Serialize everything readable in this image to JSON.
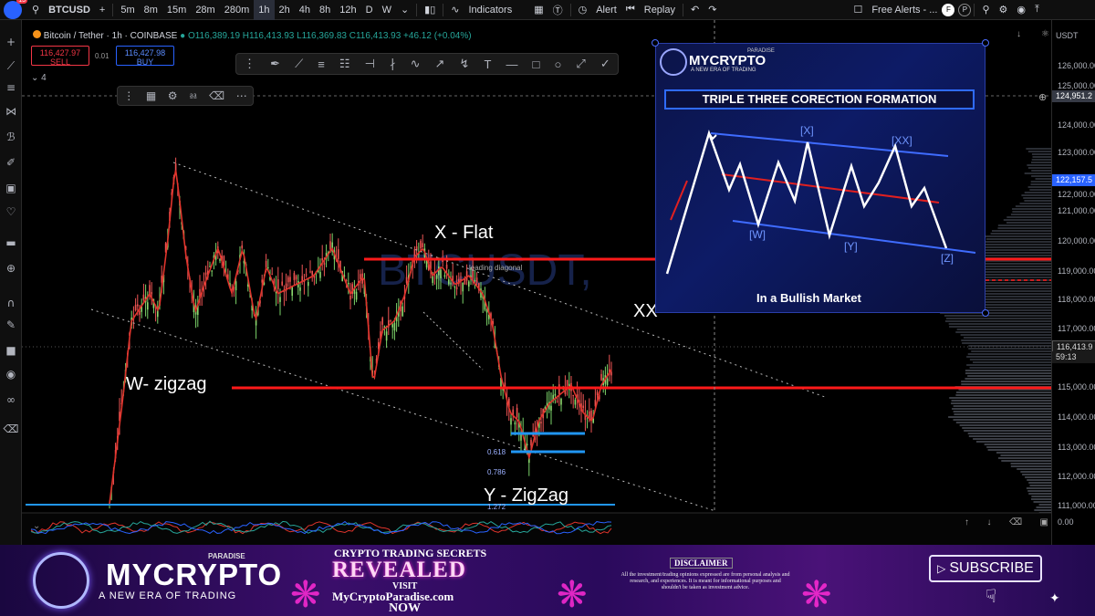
{
  "toolbar": {
    "notifications": "13",
    "symbol": "BTCUSD",
    "add_symbol": "+",
    "intervals": [
      "5m",
      "8m",
      "15m",
      "28m",
      "280m",
      "1h",
      "2h",
      "4h",
      "8h",
      "12h",
      "D",
      "W"
    ],
    "active_interval": "1h",
    "indicators_label": "Indicators",
    "alert_label": "Alert",
    "replay_label": "Replay",
    "free_alerts_label": "Free Alerts - ...",
    "avatar_letters": [
      "F",
      "P"
    ]
  },
  "legend": {
    "pair": "Bitcoin / Tether · 1h · COINBASE",
    "ohlc": "O116,389.19 H116,413.93 L116,369.83 C116,413.93 +46.12 (+0.04%)",
    "sell_price": "116,427.97",
    "sell_label": "SELL",
    "spread": "0.01",
    "buy_price": "116,427.98",
    "buy_label": "BUY",
    "indicator_count": "4"
  },
  "watermark": "BTCUSDT,",
  "annotations": {
    "x_flat": "X - Flat",
    "w_zigzag": "W- zigzag",
    "y_zigzag": "Y - ZigZag",
    "xx": "XX",
    "leading_diagonal": "leading diagonal",
    "fib_618": "0.618",
    "fib_786": "0.786",
    "fib_1272": "1.272"
  },
  "price_scale": {
    "currency": "USDT",
    "ticks": [
      "126,000.00",
      "125,000.00",
      "124,000.00",
      "123,000.00",
      "122,000.00",
      "121,000.00",
      "120,000.00",
      "119,000.00",
      "118,000.00",
      "117,000.00",
      "116,000.00",
      "115,000.00",
      "114,000.00",
      "113,000.00",
      "112,000.00",
      "111,000.00"
    ],
    "crosshair_price": "124,951.2",
    "level_tag": "122,157.5",
    "last_price": "116,413.9",
    "countdown": "59:13",
    "osc_zero": "0.00",
    "colors": {
      "up": "#26a69a",
      "down": "#ef5350",
      "level": "#ff1a1a",
      "accent": "#2962ff"
    }
  },
  "inset": {
    "brand": "MYCRYPTO",
    "brand_sup": "PARADISE",
    "tagline": "A NEW ERA OF TRADING",
    "title": "TRIPLE THREE CORECTION FORMATION",
    "labels": [
      "[X]",
      "[XX]",
      "[W]",
      "[Y]",
      "[Z]"
    ],
    "footer": "In a Bullish Market"
  },
  "banner": {
    "brand": "MYCRYPTO",
    "brand_sup": "PARADISE",
    "tagline": "A NEW ERA OF TRADING",
    "promo_line1": "CRYPTO TRADING SECRETS",
    "promo_line2": "REVEALED",
    "promo_line3": "VISIT",
    "promo_url": "MyCryptoParadise.com",
    "promo_now": "NOW",
    "disclaimer_title": "DISCLAIMER",
    "disclaimer_text": "All the investment/trading opinions expressed are from personal analysis and research, and experiences. It is meant for informational purposes and shouldn't be taken as investment advice.",
    "subscribe": "SUBSCRIBE"
  }
}
